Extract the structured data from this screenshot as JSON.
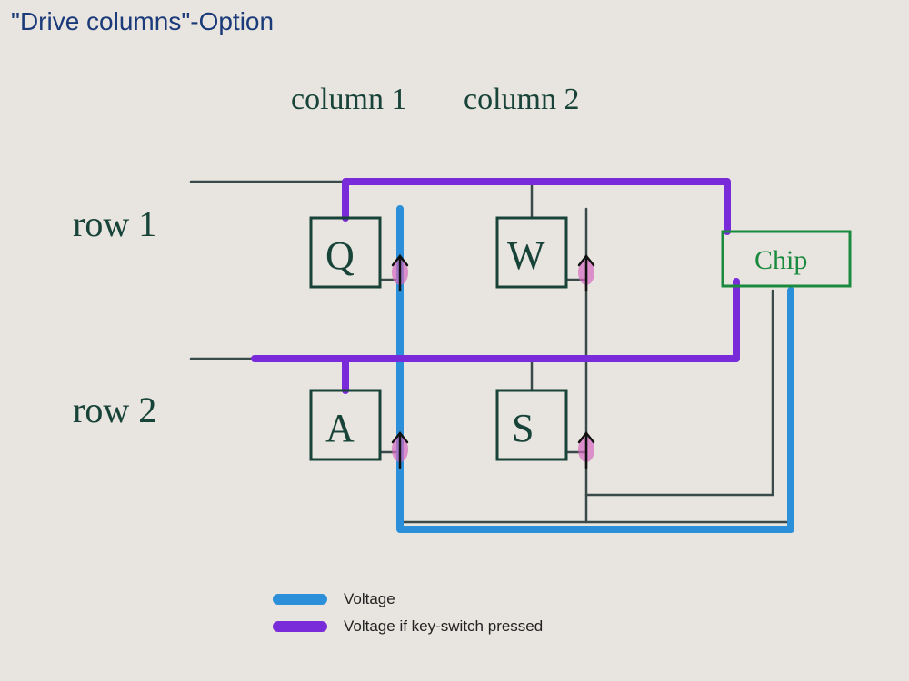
{
  "title": "\"Drive columns\"-Option",
  "labels": {
    "row1": "row 1",
    "row2": "row 2",
    "col1": "column 1",
    "col2": "column 2",
    "chip": "Chip"
  },
  "keys": {
    "Q": "Q",
    "W": "W",
    "A": "A",
    "S": "S"
  },
  "legend": {
    "voltage": "Voltage",
    "voltage_pressed": "Voltage if key-switch pressed"
  },
  "colors": {
    "voltage": "#2b8fd9",
    "voltage_pressed": "#7a2bd9",
    "ink": "#174338",
    "chip": "#1a8a3e",
    "title": "#1a3a7a"
  },
  "diagram": {
    "description": "Keyboard matrix scanning illustration for the 'drive columns' option. A 2x2 key matrix (Q, W on row 1; A, S on row 2) is wired to a controller chip. Columns are driven with voltage (blue) from the chip; rows carry voltage back to the chip (purple) only when a key-switch on that row is pressed. Diodes on each key prevent ghosting — arrows point upward from column lines toward row lines.",
    "matrix": {
      "rows": [
        "row 1",
        "row 2"
      ],
      "columns": [
        "column 1",
        "column 2"
      ],
      "keys": [
        {
          "row": 0,
          "col": 0,
          "label": "Q"
        },
        {
          "row": 0,
          "col": 1,
          "label": "W"
        },
        {
          "row": 1,
          "col": 0,
          "label": "A"
        },
        {
          "row": 1,
          "col": 1,
          "label": "S"
        }
      ]
    },
    "signals": {
      "blue": "driven column voltage (chip → columns)",
      "purple": "sensed row voltage when switch closed (rows → chip)"
    }
  }
}
